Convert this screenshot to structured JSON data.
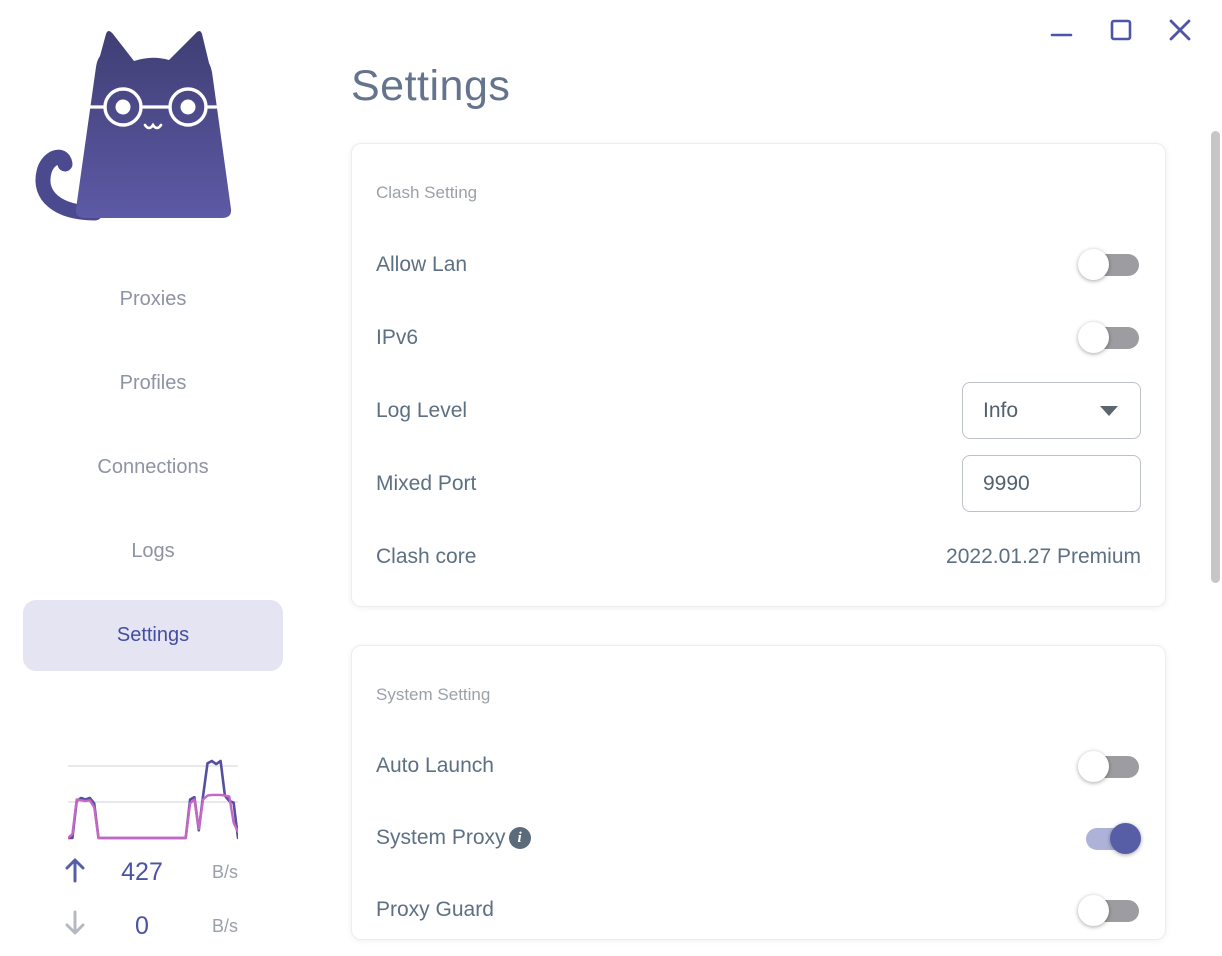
{
  "page": {
    "title": "Settings"
  },
  "window_controls": {
    "color": "#4c55a7",
    "buttons": [
      {
        "name": "minimize",
        "icon": "minimize-icon"
      },
      {
        "name": "maximize",
        "icon": "maximize-icon"
      },
      {
        "name": "close",
        "icon": "close-icon"
      }
    ]
  },
  "sidebar": {
    "logo_icon": "cat-logo",
    "items": [
      {
        "label": "Proxies",
        "active": false
      },
      {
        "label": "Profiles",
        "active": false
      },
      {
        "label": "Connections",
        "active": false
      },
      {
        "label": "Logs",
        "active": false
      },
      {
        "label": "Settings",
        "active": true
      }
    ],
    "traffic": {
      "up": {
        "icon": "arrow-up-icon",
        "value": "427",
        "unit": "B/s"
      },
      "down": {
        "icon": "arrow-down-icon",
        "value": "0",
        "unit": "B/s"
      }
    }
  },
  "cards": [
    {
      "title": "Clash Setting",
      "rows": [
        {
          "label": "Allow Lan",
          "control": "toggle",
          "state": "off"
        },
        {
          "label": "IPv6",
          "control": "toggle",
          "state": "off"
        },
        {
          "label": "Log Level",
          "control": "select",
          "value": "Info",
          "caret_icon": "chevron-down-icon"
        },
        {
          "label": "Mixed Port",
          "control": "input",
          "value": "9990"
        },
        {
          "label": "Clash core",
          "control": "text",
          "value": "2022.01.27 Premium"
        }
      ]
    },
    {
      "title": "System Setting",
      "rows": [
        {
          "label": "Auto Launch",
          "control": "toggle",
          "state": "off"
        },
        {
          "label": "System Proxy",
          "control": "toggle",
          "state": "on",
          "info": true,
          "info_icon": "info-icon"
        },
        {
          "label": "Proxy Guard",
          "control": "toggle",
          "state": "off"
        }
      ]
    }
  ],
  "colors": {
    "accent": "#575ea6",
    "accent_track_on": "#aeb2d8",
    "toggle_off_track": "#9d9da1",
    "active_pill_bg": "#e5e4f2",
    "active_nav_text": "#454da0",
    "nav_text": "#8e93a5",
    "label_text": "#5d7083",
    "section_title_text": "#9ba1a8",
    "page_title_text": "#64748c",
    "window_controls": "#4c55a7",
    "upload_line": "#554fa0",
    "download_line": "#c766c4",
    "gridline": "#e9e9ec",
    "scrollbar": "#c6c6c9",
    "logo_gradient_top": "#403e74",
    "logo_gradient_bottom": "#5d5aa6"
  },
  "chart_data": {
    "type": "line",
    "title": "traffic-sparkline",
    "ylabel": "B/s",
    "grid": true,
    "legend": "none",
    "x": "recent time (unlabeled sparkline, 40 samples)",
    "series": [
      {
        "name": "upload",
        "color": "#554fa0",
        "values": [
          0,
          0,
          48,
          52,
          50,
          52,
          45,
          0,
          0,
          0,
          0,
          0,
          0,
          0,
          0,
          0,
          0,
          0,
          0,
          0,
          0,
          0,
          0,
          0,
          0,
          0,
          0,
          0,
          50,
          53,
          10,
          55,
          97,
          100,
          96,
          100,
          55,
          48,
          46,
          0
        ]
      },
      {
        "name": "download",
        "color": "#c766c4",
        "values": [
          0,
          5,
          50,
          49,
          48,
          49,
          40,
          0,
          0,
          0,
          0,
          0,
          0,
          0,
          0,
          0,
          0,
          0,
          0,
          0,
          0,
          0,
          0,
          0,
          0,
          0,
          0,
          0,
          45,
          50,
          12,
          50,
          55,
          56,
          56,
          56,
          55,
          54,
          20,
          8
        ]
      }
    ]
  }
}
